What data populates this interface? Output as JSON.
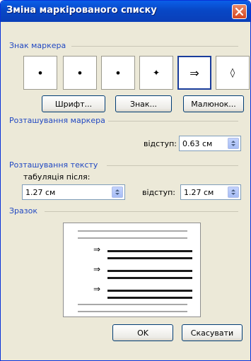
{
  "window": {
    "title": "Зміна маркірованого списку",
    "close_label": "close"
  },
  "bullet_group": {
    "label": "Знак маркера",
    "bullets": [
      "•",
      "•",
      "•",
      "✦",
      "⇒",
      "◊"
    ],
    "selected_index": 4
  },
  "buttons": {
    "font": "Шрифт...",
    "symbol": "Знак...",
    "picture": "Малюнок..."
  },
  "marker_position": {
    "label": "Розташування маркера",
    "indent_label": "відступ:",
    "indent_value": "0.63 см"
  },
  "text_position": {
    "label": "Розташування тексту",
    "tab_label": "табуляція після:",
    "tab_value": "1.27 см",
    "indent_label": "відступ:",
    "indent_value": "1.27 см"
  },
  "preview": {
    "label": "Зразок",
    "bullet_symbol": "⇒"
  },
  "footer": {
    "ok": "OK",
    "cancel": "Скасувати"
  },
  "colors": {
    "title_bar": "#0847c6",
    "group_label": "#2148c2",
    "dialog_bg": "#ece9d8"
  }
}
